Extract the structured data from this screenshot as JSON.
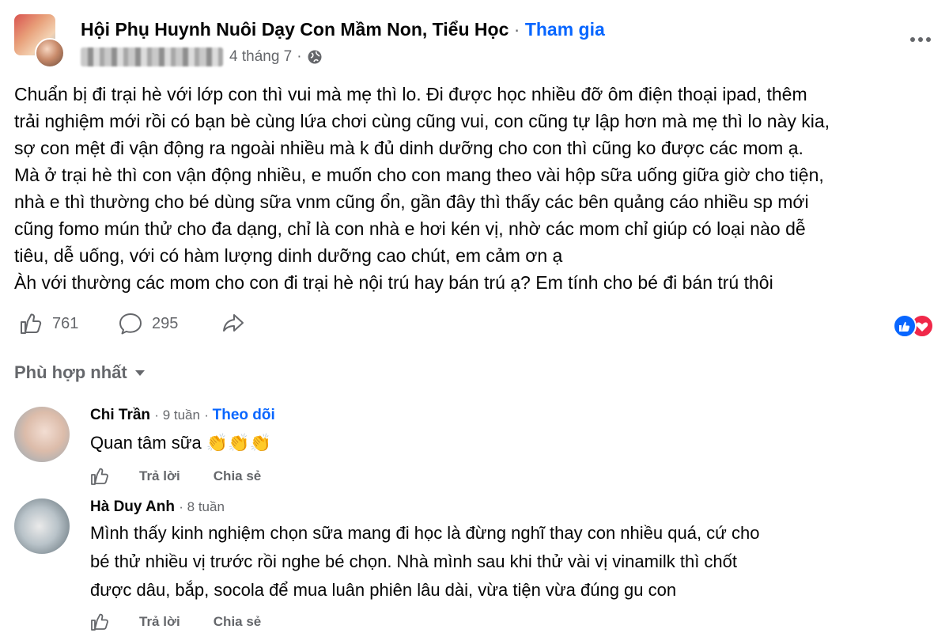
{
  "post": {
    "group_name": "Hội Phụ Huynh Nuôi Dạy Con Mầm Non, Tiểu Học",
    "separator": "·",
    "join_label": "Tham gia",
    "date": "4 tháng 7",
    "date_separator": "·",
    "body": [
      "Chuẩn bị đi trại hè với lớp con thì vui mà mẹ thì lo. Đi được học nhiều đỡ ôm điện thoại ipad, thêm",
      "trải nghiệm mới rồi có bạn bè cùng lứa chơi cùng cũng vui, con cũng tự lập hơn mà mẹ thì lo này kia,",
      "sợ con mệt đi vận động ra ngoài nhiều mà k đủ dinh dưỡng cho con thì cũng ko được các mom ạ.",
      "Mà ở trại hè thì con vận động nhiều, e muốn cho con mang theo vài hộp sữa uống giữa giờ cho tiện,",
      "nhà e thì thường cho bé dùng sữa vnm cũng ổn, gần đây thì thấy các bên quảng cáo nhiều sp mới",
      "cũng fomo mún thử cho đa dạng, chỉ là con nhà e hơi kén vị, nhờ các mom chỉ giúp có loại nào dễ",
      "tiêu, dễ uống, với có hàm lượng dinh dưỡng cao chút, em cảm ơn ạ",
      "Àh với thường các mom cho con đi trại hè nội trú hay bán trú ạ? Em tính cho bé đi bán trú thôi"
    ],
    "like_count": "761",
    "comment_count": "295"
  },
  "icons": {
    "like": "thumbs-up-icon",
    "comment": "comment-bubble-icon",
    "share": "share-arrow-icon",
    "globe": "globe-icon",
    "more": "more-options-icon",
    "reactions": "like-love-reactions-icon",
    "sort": "caret-down-icon"
  },
  "sort_label": "Phù hợp nhất",
  "comments": [
    {
      "name": "Chi Trần",
      "time": "9 tuần",
      "follow_label": "Theo dõi",
      "text": "Quan tâm sữa",
      "emoji": "👏👏👏",
      "reply_label": "Trả lời",
      "share_label": "Chia sẻ"
    },
    {
      "name": "Hà Duy Anh",
      "time": "8 tuần",
      "text_lines": [
        "Mình thấy kinh nghiệm chọn sữa mang đi học là đừng nghĩ thay con nhiều quá, cứ cho",
        "bé thử nhiều vị trước rồi nghe bé chọn. Nhà mình sau khi thử vài vị vinamilk thì chốt",
        "được dâu, bắp, socola để mua luân phiên lâu dài, vừa tiện vừa đúng gu con"
      ],
      "reply_label": "Trả lời",
      "share_label": "Chia sẻ"
    }
  ],
  "colors": {
    "link_blue": "#0866ff",
    "secondary_text": "#65676b",
    "love_red": "#f02849"
  }
}
